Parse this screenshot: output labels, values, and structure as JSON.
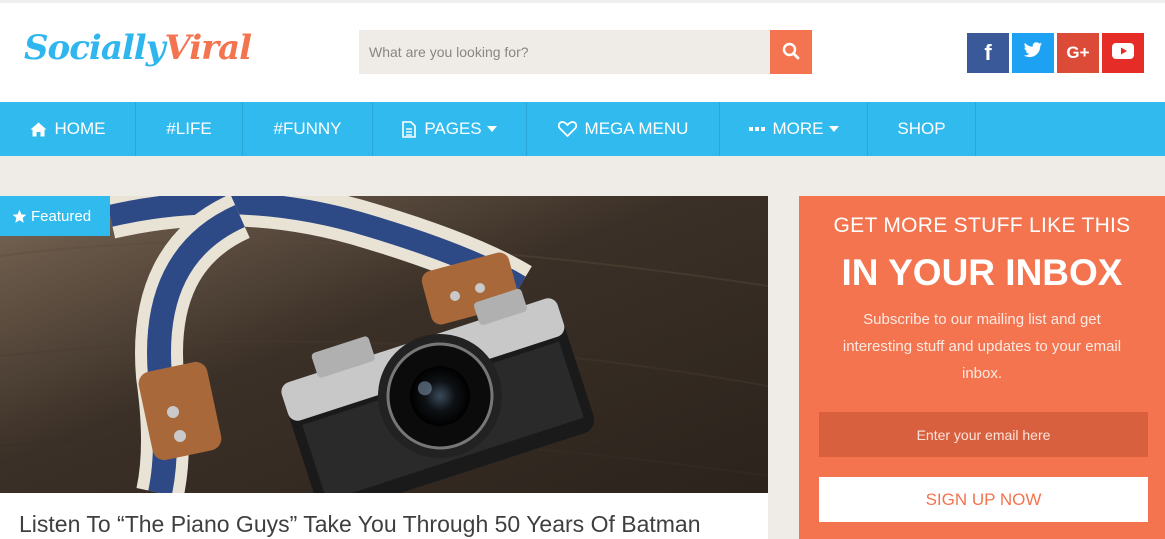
{
  "header": {
    "logo_part1": "Socially",
    "logo_part2": "Viral",
    "search_placeholder": "What are you looking for?",
    "social": [
      {
        "name": "facebook",
        "glyph": "f"
      },
      {
        "name": "twitter",
        "glyph": ""
      },
      {
        "name": "google-plus",
        "glyph": "G+"
      },
      {
        "name": "youtube",
        "glyph": ""
      }
    ]
  },
  "nav": {
    "items": [
      {
        "label": "HOME",
        "icon": "home-icon"
      },
      {
        "label": "#LIFE"
      },
      {
        "label": "#FUNNY"
      },
      {
        "label": "PAGES",
        "icon": "document-icon",
        "dropdown": true
      },
      {
        "label": "MEGA MENU",
        "icon": "heart-icon"
      },
      {
        "label": "MORE",
        "icon": "dots-icon",
        "dropdown": true
      },
      {
        "label": "SHOP"
      }
    ]
  },
  "featured": {
    "badge": "Featured",
    "title": "Listen To “The Piano Guys” Take You Through 50 Years Of Batman"
  },
  "subscribe": {
    "top": "GET MORE STUFF LIKE THIS",
    "big": "IN YOUR INBOX",
    "desc": "Subscribe to our mailing list and get interesting stuff and updates to your email inbox.",
    "email_placeholder": "Enter your email here",
    "button": "SIGN UP NOW"
  },
  "colors": {
    "brand_blue": "#31baee",
    "brand_orange": "#f3744f",
    "page_bg": "#efebe7"
  }
}
